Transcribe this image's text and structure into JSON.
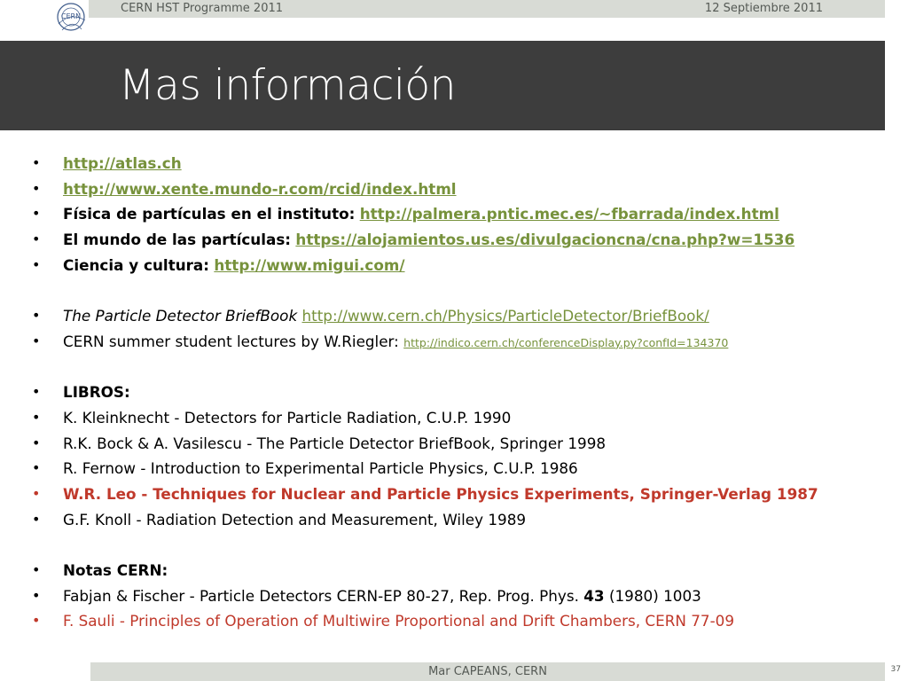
{
  "header": {
    "program": "CERN HST Programme 2011",
    "date": "12 Septiembre 2011",
    "logo_text": "CERN"
  },
  "slide": {
    "title": "Mas información"
  },
  "items": [
    {
      "link": "http://atlas.ch"
    },
    {
      "link": "http://www.xente.mundo-r.com/rcid/index.html"
    },
    {
      "label": "Física de partículas en el instituto:",
      "link": "http://palmera.pntic.mec.es/~fbarrada/index.html"
    },
    {
      "label": "El mundo de las partículas:",
      "link": "https://alojamientos.us.es/divulgacioncna/cna.php?w=1536"
    },
    {
      "label": "Ciencia y cultura:",
      "link": "http://www.migui.com/"
    },
    {
      "italic": "The Particle Detector BriefBook",
      "link": "http://www.cern.ch/Physics/ParticleDetector/BriefBook/"
    },
    {
      "text": "CERN summer student lectures by W.Riegler:",
      "link": "http://indico.cern.ch/conferenceDisplay.py?confId=134370"
    },
    {
      "heading": "LIBROS:"
    },
    {
      "text": "K. Kleinknecht - Detectors for Particle Radiation, C.U.P. 1990"
    },
    {
      "text": "R.K. Bock & A. Vasilescu - The Particle Detector BriefBook, Springer 1998"
    },
    {
      "text": "R. Fernow - Introduction to Experimental Particle Physics, C.U.P. 1986"
    },
    {
      "text": "W.R. Leo - Techniques for Nuclear and Particle Physics Experiments, Springer-Verlag 1987"
    },
    {
      "text": "G.F. Knoll - Radiation Detection and Measurement, Wiley 1989"
    },
    {
      "heading": "Notas CERN:"
    },
    {
      "text_before": "Fabjan & Fischer - Particle Detectors CERN-EP 80-27, Rep. Prog. Phys.",
      "bold": "43",
      "text_after": "(1980) 1003"
    },
    {
      "text": "F. Sauli - Principles of Operation of Multiwire Proportional and Drift Chambers, CERN 77-09"
    }
  ],
  "colors": {
    "title_band": "#3d3d3d",
    "link": "#77923c",
    "highlight": "#c0392b"
  },
  "footer": {
    "author": "Mar CAPEANS, CERN",
    "page": "37"
  }
}
